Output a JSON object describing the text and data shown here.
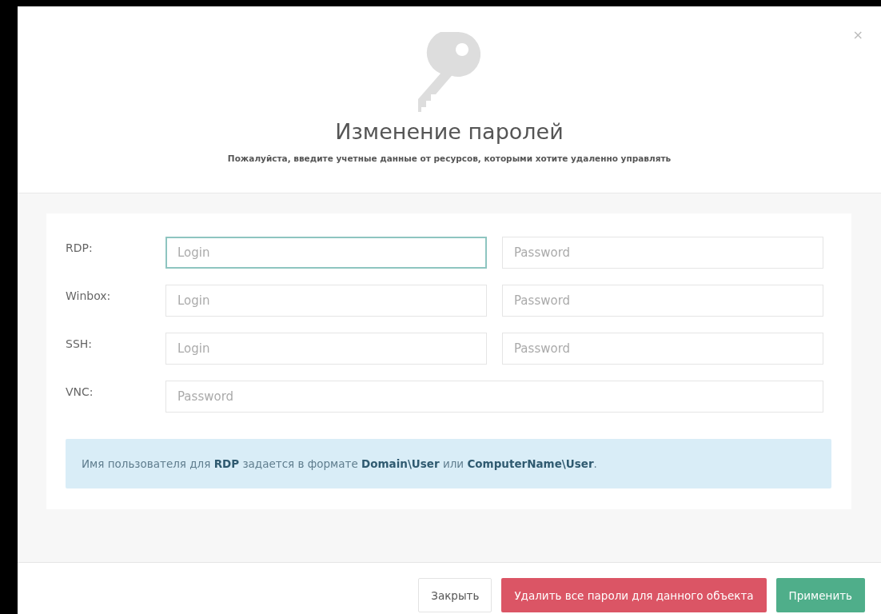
{
  "dialog": {
    "close": "×",
    "title": "Изменение паролей",
    "subtitle": "Пожалуйста, введите учетные данные от ресурсов, которыми хотите удаленно управлять"
  },
  "rows": [
    {
      "label": "RDP:",
      "fields": [
        {
          "placeholder": "Login",
          "focused": true
        },
        {
          "placeholder": "Password",
          "focused": false
        }
      ]
    },
    {
      "label": "Winbox:",
      "fields": [
        {
          "placeholder": "Login",
          "focused": false
        },
        {
          "placeholder": "Password",
          "focused": false
        }
      ]
    },
    {
      "label": "SSH:",
      "fields": [
        {
          "placeholder": "Login",
          "focused": false
        },
        {
          "placeholder": "Password",
          "focused": false
        }
      ]
    },
    {
      "label": "VNC:",
      "fields": [
        {
          "placeholder": "Password",
          "focused": false
        }
      ]
    }
  ],
  "note": "Имя пользователя для **RDP** задается в формате **Domain\\User** или **ComputerName\\User**.",
  "buttons": [
    {
      "label": "Закрыть",
      "kind": "default"
    },
    {
      "label": "Удалить все пароли для данного объекта",
      "kind": "danger"
    },
    {
      "label": "Применить",
      "kind": "success"
    }
  ]
}
